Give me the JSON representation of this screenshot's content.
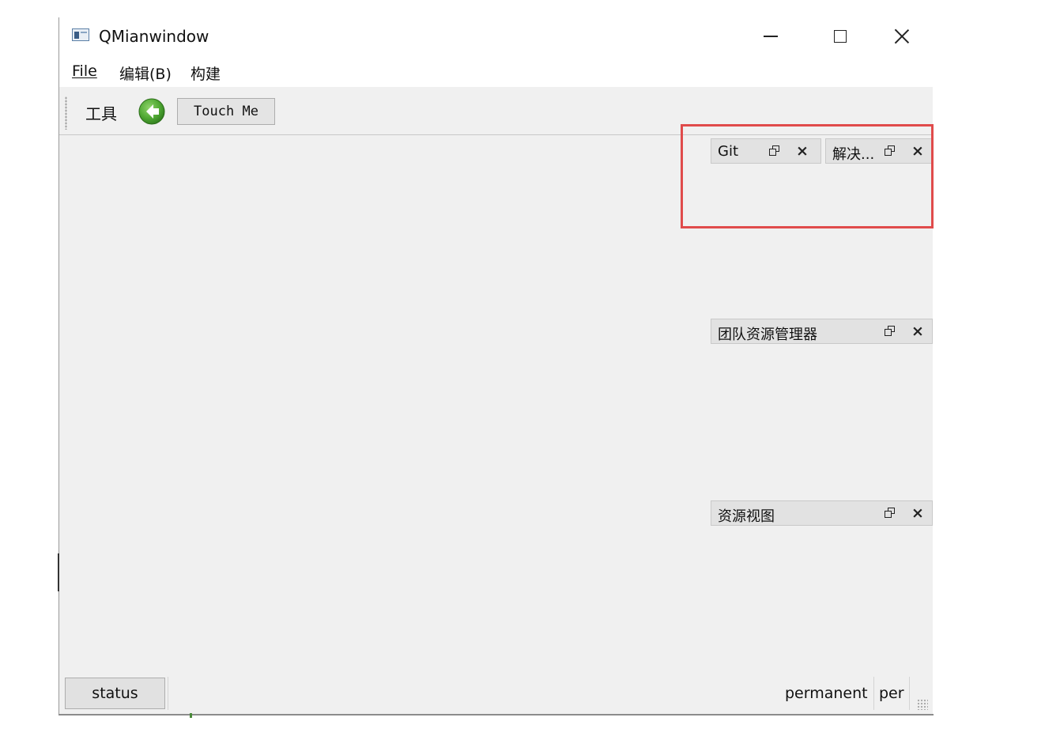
{
  "window": {
    "title": "QMianwindow"
  },
  "menubar": {
    "items": [
      {
        "label": "File"
      },
      {
        "label": "编辑(B)"
      },
      {
        "label": "构建"
      }
    ]
  },
  "toolbar": {
    "tool_label": "工具",
    "back_icon": "back-arrow-icon",
    "touch_button_label": "Touch Me"
  },
  "docks": [
    {
      "title": "Git"
    },
    {
      "title": "解决..."
    },
    {
      "title": "团队资源管理器"
    },
    {
      "title": "资源视图"
    }
  ],
  "statusbar": {
    "status_label": "status",
    "permanent_label": "permanent",
    "per_label": "per"
  },
  "colors": {
    "highlight": "#e04b4b",
    "back_icon_green": "#4fa833"
  }
}
